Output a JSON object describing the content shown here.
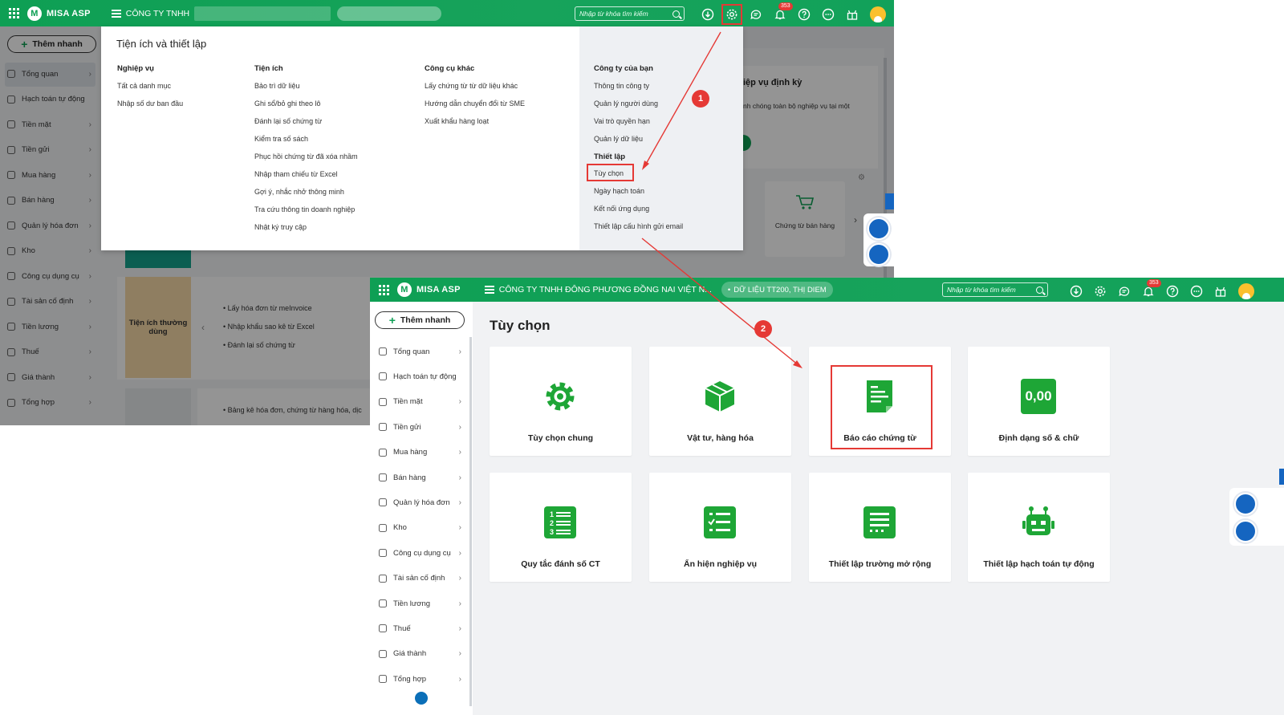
{
  "topbar": {
    "app_name": "MISA ASP",
    "company_1": "CÔNG TY TNHH",
    "company_2": "CÔNG TY TNHH ĐÔNG PHƯƠNG ĐỒNG NAI VIỆT N...",
    "data_pill_2": "DỮ LIỆU TT200, THỊ DIEM",
    "search_placeholder": "Nhập từ khóa tìm kiếm",
    "notification_count": "353"
  },
  "quick_add_label": "Thêm nhanh",
  "sidebar": {
    "items": [
      {
        "label": "Tổng quan",
        "icon": "monitor-icon",
        "chevron": true
      },
      {
        "label": "Hạch toán tự động",
        "icon": "gear-cycle-icon",
        "chevron": false
      },
      {
        "label": "Tiền mặt",
        "icon": "money-bag-icon",
        "chevron": true
      },
      {
        "label": "Tiền gửi",
        "icon": "bank-icon",
        "chevron": true
      },
      {
        "label": "Mua hàng",
        "icon": "shopping-bag-icon",
        "chevron": true
      },
      {
        "label": "Bán hàng",
        "icon": "cart-icon",
        "chevron": true
      },
      {
        "label": "Quản lý hóa đơn",
        "icon": "invoice-icon",
        "chevron": true
      },
      {
        "label": "Kho",
        "icon": "warehouse-icon",
        "chevron": true
      },
      {
        "label": "Công cụ dụng cụ",
        "icon": "tools-icon",
        "chevron": true
      },
      {
        "label": "Tài sản cố định",
        "icon": "asset-icon",
        "chevron": true
      },
      {
        "label": "Tiền lương",
        "icon": "salary-icon",
        "chevron": true
      },
      {
        "label": "Thuế",
        "icon": "tax-icon",
        "chevron": true
      },
      {
        "label": "Giá thành",
        "icon": "price-tag-icon",
        "chevron": true
      },
      {
        "label": "Tổng hợp",
        "icon": "summary-icon",
        "chevron": true
      }
    ]
  },
  "dropdown": {
    "title": "Tiện ích và thiết lập",
    "columns": [
      {
        "heading": "Nghiệp vụ",
        "items": [
          "Tất cả danh mục",
          "Nhập số dư ban đầu"
        ]
      },
      {
        "heading": "Tiện ích",
        "items": [
          "Bảo trì dữ liệu",
          "Ghi sổ/bỏ ghi theo lô",
          "Đánh lại số chứng từ",
          "Kiểm tra số sách",
          "Phục hồi chứng từ đã xóa nhầm",
          "Nhập tham chiếu từ Excel",
          "Gợi ý, nhắc nhở thông minh",
          "Tra cứu thông tin doanh nghiệp",
          "Nhật ký truy cập"
        ]
      },
      {
        "heading": "Công cụ khác",
        "items": [
          "Lấy chứng từ từ dữ liệu khác",
          "Hướng dẫn chuyển đổi từ SME",
          "Xuất khẩu hàng loạt"
        ]
      }
    ],
    "company_heading": "Công ty của bạn",
    "company_items": [
      "Thông tin công ty",
      "Quản lý người dùng",
      "Vai trò quyền hạn",
      "Quản lý dữ liệu"
    ],
    "setup_heading": "Thiết lập",
    "setup_items": [
      "Tùy chọn",
      "Ngày hạch toán",
      "Kết nối ứng dụng",
      "Thiết lập cấu hình gửi email"
    ]
  },
  "background": {
    "card_heading": "iệp vụ định kỳ",
    "card_text": "nh chóng toàn bộ nghiệp vụ tại một",
    "voucher_sales": "Chứng từ bán hàng",
    "util_title": "Tiện ích thường dùng",
    "util_items": [
      "Lấy hóa đơn từ meInvoice",
      "Nhập khẩu sao kê từ Excel",
      "Đánh lại số chứng từ"
    ],
    "bottom_text": "Bảng kê hóa đơn, chứng từ hàng hóa, dịc"
  },
  "options_page": {
    "title": "Tùy chọn",
    "tiles": [
      {
        "label": "Tùy chọn chung",
        "icon": "gear-icon"
      },
      {
        "label": "Vật tư, hàng hóa",
        "icon": "box-icon"
      },
      {
        "label": "Báo cáo chứng từ",
        "icon": "report-document-icon"
      },
      {
        "label": "Định dạng số & chữ",
        "icon": "number-format-icon",
        "icon_text": "0,00"
      },
      {
        "label": "Quy tắc đánh số CT",
        "icon": "numbered-list-icon"
      },
      {
        "label": "Ẩn hiện nghiệp vụ",
        "icon": "checklist-icon"
      },
      {
        "label": "Thiết lập trường mở rộng",
        "icon": "extended-fields-icon"
      },
      {
        "label": "Thiết lập hạch toán tự động",
        "icon": "robot-icon"
      }
    ]
  },
  "annotations": {
    "step1": "1",
    "step2": "2"
  },
  "colors": {
    "brand_green": "#0e9f54",
    "highlight_red": "#e53935",
    "tile_green": "#1ea636"
  }
}
